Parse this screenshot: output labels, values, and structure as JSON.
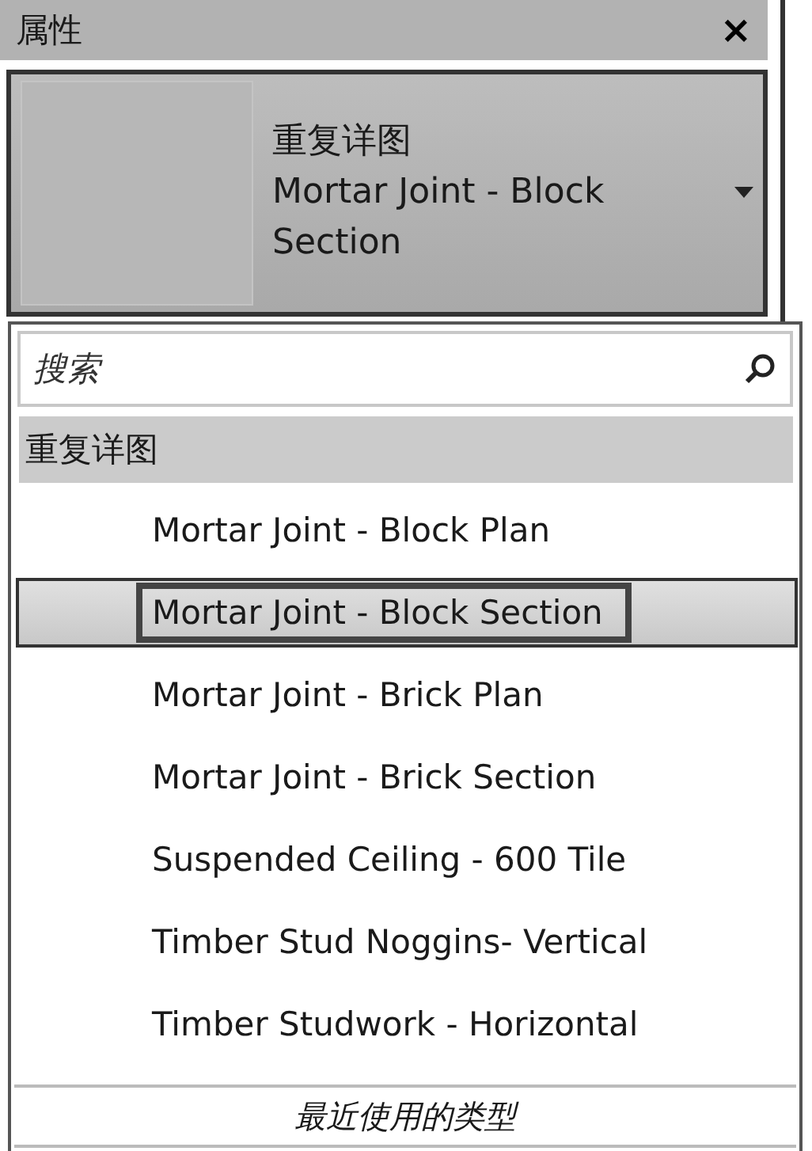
{
  "panel": {
    "title": "属性",
    "close": "×"
  },
  "type_selector": {
    "family": "重复详图",
    "type": "Mortar Joint - Block Section"
  },
  "search": {
    "placeholder": "搜索"
  },
  "group": {
    "label": "重复详图"
  },
  "items": [
    {
      "label": "Mortar Joint - Block Plan",
      "selected": false
    },
    {
      "label": "Mortar Joint - Block Section",
      "selected": true
    },
    {
      "label": "Mortar Joint - Brick Plan",
      "selected": false
    },
    {
      "label": "Mortar Joint - Brick Section",
      "selected": false
    },
    {
      "label": "Suspended Ceiling - 600 Tile",
      "selected": false
    },
    {
      "label": "Timber Stud Noggins- Vertical",
      "selected": false
    },
    {
      "label": "Timber Studwork - Horizontal",
      "selected": false
    }
  ],
  "footer": {
    "label": "最近使用的类型"
  }
}
